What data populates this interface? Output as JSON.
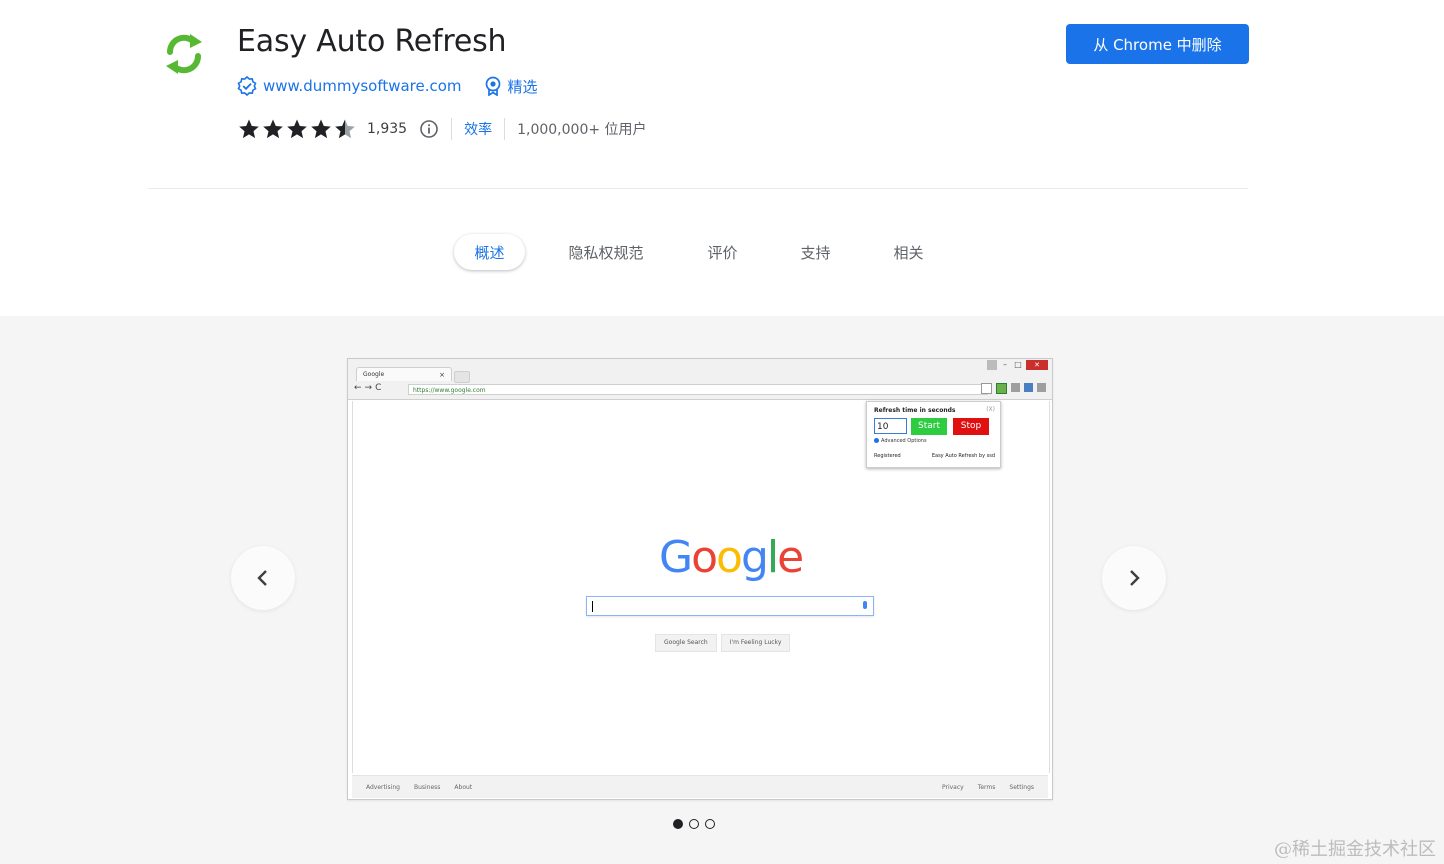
{
  "extension": {
    "name": "Easy Auto Refresh",
    "website": "www.dummysoftware.com",
    "featured_label": "精选",
    "rating": 4.5,
    "rating_count": "1,935",
    "category": "效率",
    "users": "1,000,000+ 位用户",
    "icon": "refresh-arrows-icon",
    "remove_button": "从 Chrome 中删除"
  },
  "tabs": [
    {
      "label": "概述",
      "active": true
    },
    {
      "label": "隐私权规范",
      "active": false
    },
    {
      "label": "评价",
      "active": false
    },
    {
      "label": "支持",
      "active": false
    },
    {
      "label": "相关",
      "active": false
    }
  ],
  "screenshot": {
    "browser_tab_title": "Google",
    "url": "https://www.google.com",
    "popup": {
      "title": "Refresh time in seconds",
      "close": "(X)",
      "seconds": "10",
      "start": "Start",
      "stop": "Stop",
      "advanced": "Advanced Options",
      "registered": "Registered",
      "credit": "Easy Auto Refresh by ssd"
    },
    "search_buttons": [
      "Google Search",
      "I'm Feeling Lucky"
    ],
    "footer_left": [
      "Advertising",
      "Business",
      "About"
    ],
    "footer_right": [
      "Privacy",
      "Terms",
      "Settings"
    ]
  },
  "carousel": {
    "slide_count": 3,
    "active_index": 0
  },
  "colors": {
    "accent": "#1a73e8",
    "icon_green": "#57b832",
    "gallery_bg": "#f5f5f5"
  },
  "watermark": "@稀土掘金技术社区"
}
